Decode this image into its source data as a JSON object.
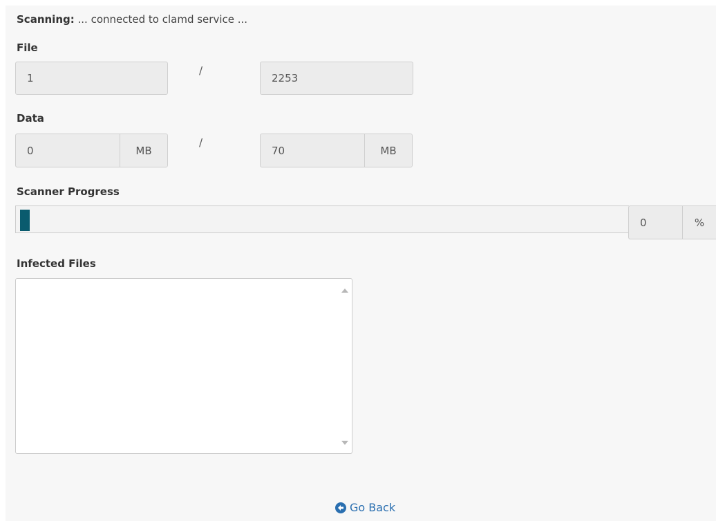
{
  "status": {
    "key": "Scanning:",
    "text": "... connected to clamd service ..."
  },
  "file": {
    "label": "File",
    "current": "1",
    "separator": "/",
    "total": "2253"
  },
  "data": {
    "label": "Data",
    "current": "0",
    "current_unit": "MB",
    "separator": "/",
    "total": "70",
    "total_unit": "MB"
  },
  "progress": {
    "label": "Scanner Progress",
    "value": "0",
    "unit": "%",
    "fill_color": "#0a5b6e"
  },
  "infected": {
    "label": "Infected Files",
    "value": ""
  },
  "actions": {
    "go_back_label": "Go Back",
    "go_back_icon": "arrow-left-circle-icon"
  }
}
